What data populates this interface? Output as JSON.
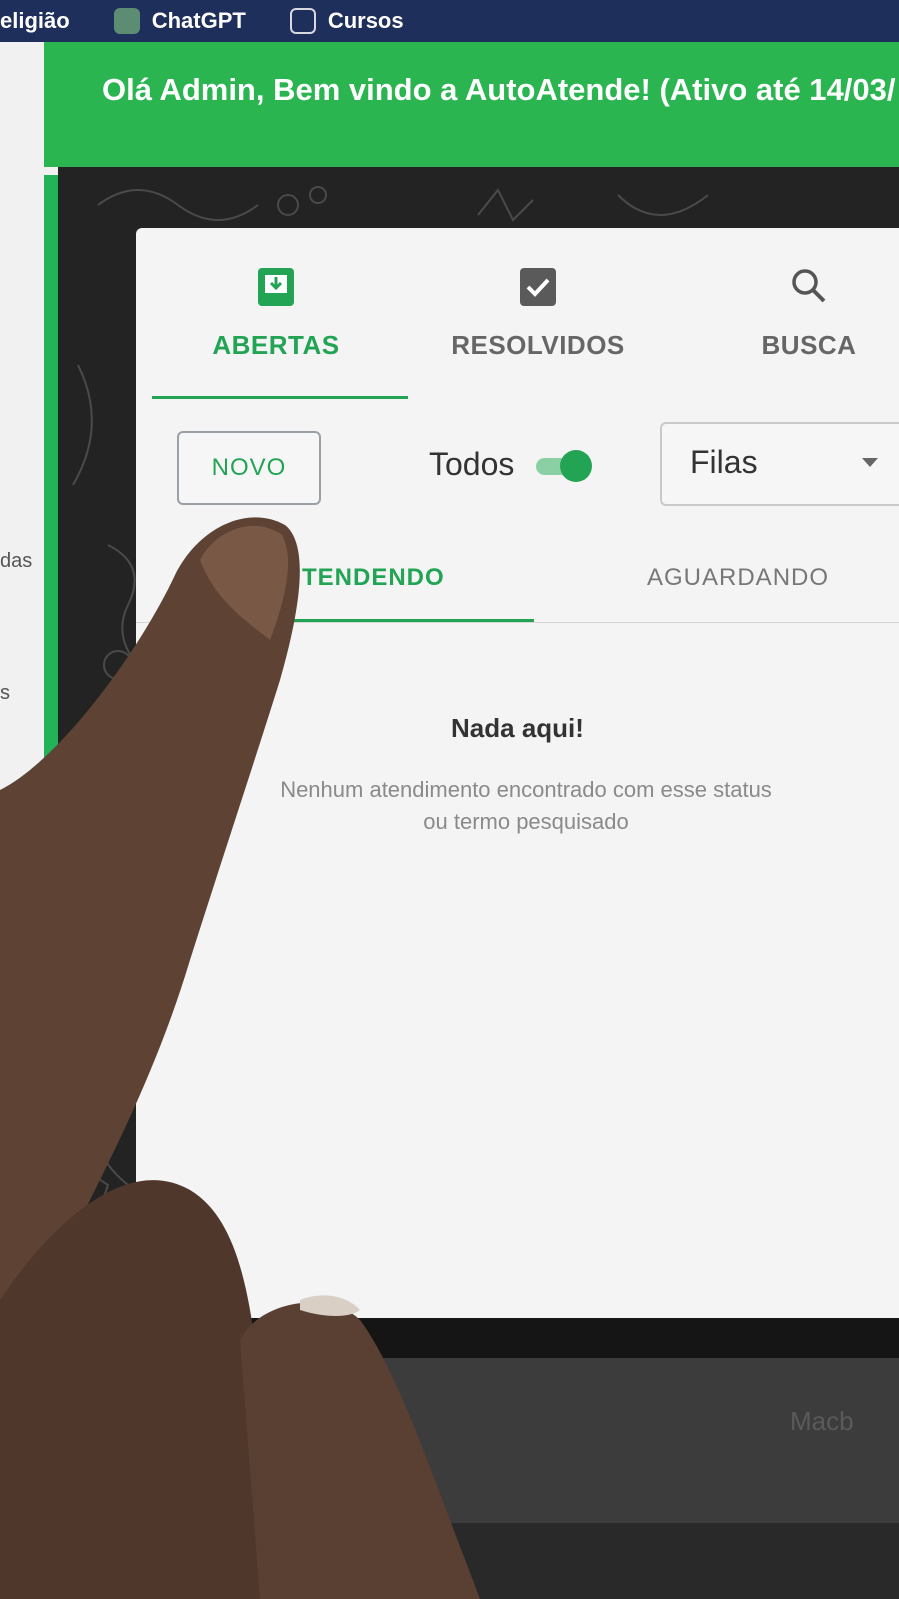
{
  "bookmarks": [
    {
      "label": "eligião",
      "icon": "none"
    },
    {
      "label": "ChatGPT",
      "icon": "chatgpt-icon"
    },
    {
      "label": "Cursos",
      "icon": "folder-icon"
    }
  ],
  "greeting": "Olá Admin, Bem vindo a AutoAtende! (Ativo até 14/03/",
  "left_sidebar": {
    "text_a": "das",
    "text_b": "s"
  },
  "tabs": [
    {
      "label": "ABERTAS",
      "icon": "inbox-download-icon",
      "active": true
    },
    {
      "label": "RESOLVIDOS",
      "icon": "checkbox-icon",
      "active": false
    },
    {
      "label": "BUSCA",
      "icon": "search-icon",
      "active": false
    }
  ],
  "actions": {
    "novo_label": "NOVO",
    "todos_label": "Todos",
    "todos_on": true,
    "filas_value": "Filas"
  },
  "sub_tabs": [
    {
      "label": "TENDENDO",
      "active": true
    },
    {
      "label": "AGUARDANDO",
      "active": false
    }
  ],
  "empty_state": {
    "title": "Nada aqui!",
    "message": "Nenhum atendimento encontrado com esse status ou termo pesquisado"
  },
  "device_brand": "Macb",
  "colors": {
    "accent": "#23a455",
    "header_bar": "#2bb550",
    "bookmarks_bar": "#1f2f5c"
  }
}
